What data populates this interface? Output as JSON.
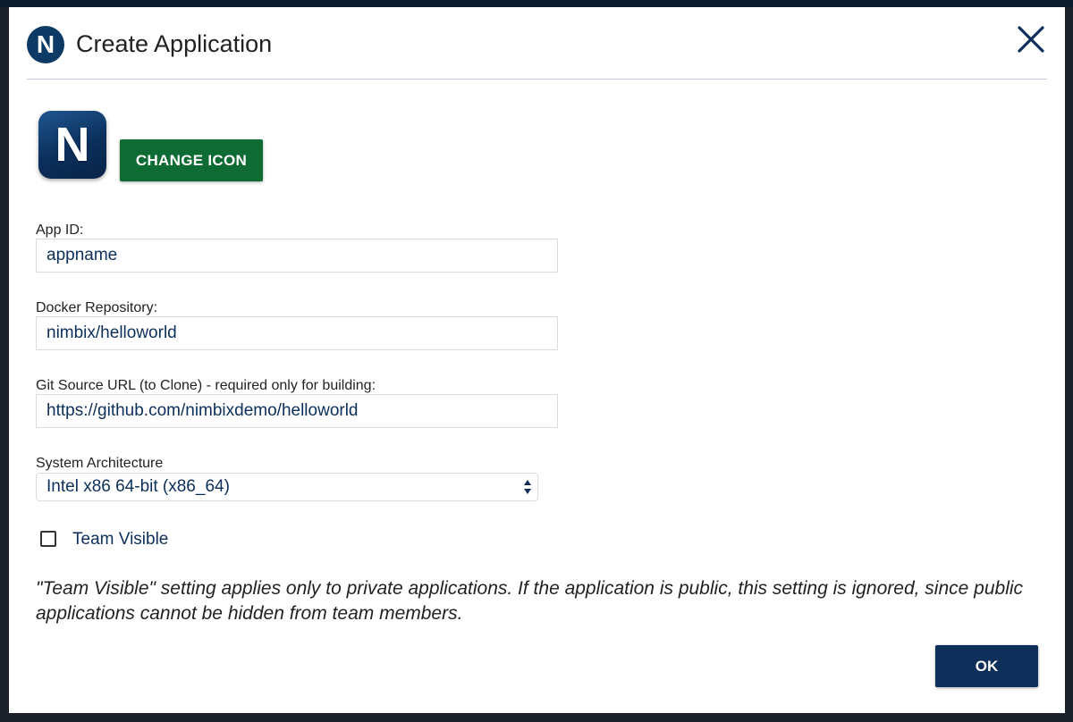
{
  "dialog": {
    "title": "Create Application",
    "logo_letter": "N",
    "close_icon": "close-icon"
  },
  "icon_section": {
    "app_icon_letter": "N",
    "change_icon_label": "CHANGE ICON"
  },
  "fields": {
    "app_id": {
      "label": "App ID:",
      "value": "appname"
    },
    "docker_repo": {
      "label": "Docker Repository:",
      "value": "nimbix/helloworld"
    },
    "git_source": {
      "label": "Git Source URL (to Clone) - required only for building:",
      "value": "https://github.com/nimbixdemo/helloworld"
    },
    "architecture": {
      "label": "System Architecture",
      "value": "Intel x86 64-bit (x86_64)"
    }
  },
  "team_visible": {
    "label": "Team Visible",
    "checked": false
  },
  "note": "\"Team Visible\" setting applies only to private applications. If the application is public, this setting is ignored, since public applications cannot be hidden from team members.",
  "actions": {
    "ok_label": "OK"
  },
  "colors": {
    "primary_navy": "#0d2f5a",
    "accent_green": "#0e6b34",
    "overlay": "#1c2129"
  }
}
